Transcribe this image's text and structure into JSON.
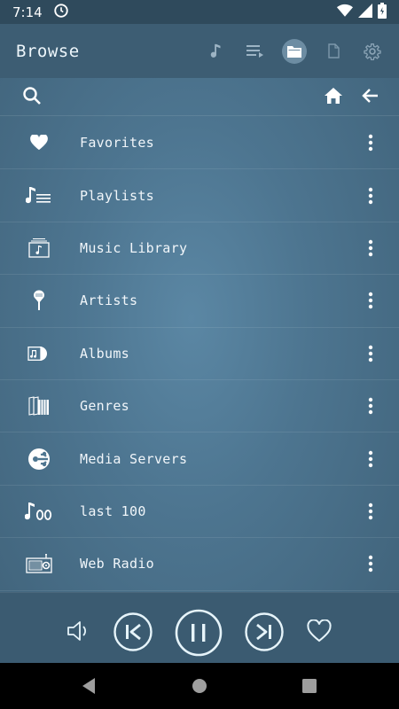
{
  "status_bar": {
    "time": "7:14"
  },
  "toolbar": {
    "title": "Browse",
    "icons": [
      "music-note-icon",
      "queue-icon",
      "folder-icon",
      "file-icon",
      "settings-icon"
    ]
  },
  "search_row": {
    "icons": [
      "search-icon",
      "home-icon",
      "back-arrow-icon"
    ]
  },
  "browse_items": [
    {
      "label": "Favorites",
      "icon": "heart-icon"
    },
    {
      "label": "Playlists",
      "icon": "playlist-icon"
    },
    {
      "label": "Music Library",
      "icon": "music-library-icon"
    },
    {
      "label": "Artists",
      "icon": "microphone-icon"
    },
    {
      "label": "Albums",
      "icon": "album-icon"
    },
    {
      "label": "Genres",
      "icon": "genres-icon"
    },
    {
      "label": "Media Servers",
      "icon": "media-server-icon"
    },
    {
      "label": "last 100",
      "icon": "last-100-icon"
    },
    {
      "label": "Web Radio",
      "icon": "radio-icon"
    }
  ],
  "player": {
    "controls": [
      "volume-icon",
      "previous-icon",
      "pause-icon",
      "next-icon",
      "favorite-icon"
    ],
    "state": "playing"
  },
  "colors": {
    "background": "#4d7590",
    "toolbar": "#3d5d73",
    "status_bar": "#2f4a5c",
    "player_bar": "#3b5b71",
    "accent": "#e6f4fa"
  }
}
